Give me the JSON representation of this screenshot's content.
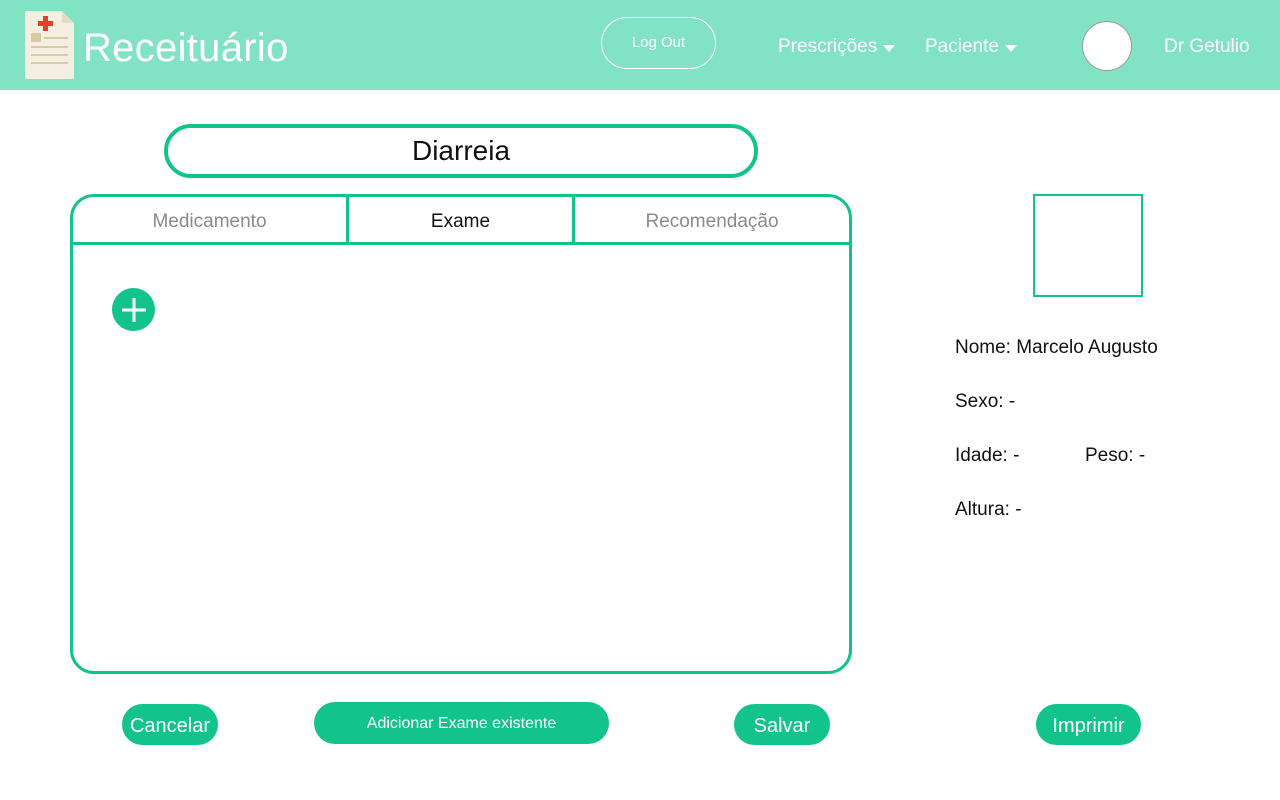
{
  "header": {
    "app_title": "Receituário",
    "logout_label": "Log Out",
    "nav": [
      {
        "label": "Prescrições"
      },
      {
        "label": "Paciente"
      }
    ],
    "user_name": "Dr Getulio"
  },
  "prescription": {
    "title": "Diarreia",
    "tabs": [
      {
        "label": "Medicamento"
      },
      {
        "label": "Exame"
      },
      {
        "label": "Recomendação"
      }
    ],
    "active_tab": "Exame"
  },
  "patient": {
    "nome": "Nome: Marcelo Augusto",
    "sexo": "Sexo: -",
    "idade": "Idade: -",
    "peso": "Peso: -",
    "altura": "Altura: -"
  },
  "actions": {
    "cancelar": "Cancelar",
    "adicionar": "Adicionar Exame existente",
    "salvar": "Salvar",
    "imprimir": "Imprimir"
  },
  "colors": {
    "header_bg": "#82e3c4",
    "accent": "#12c48c"
  },
  "icons": [
    "prescription-document-icon",
    "caret-down-icon",
    "plus-icon"
  ]
}
